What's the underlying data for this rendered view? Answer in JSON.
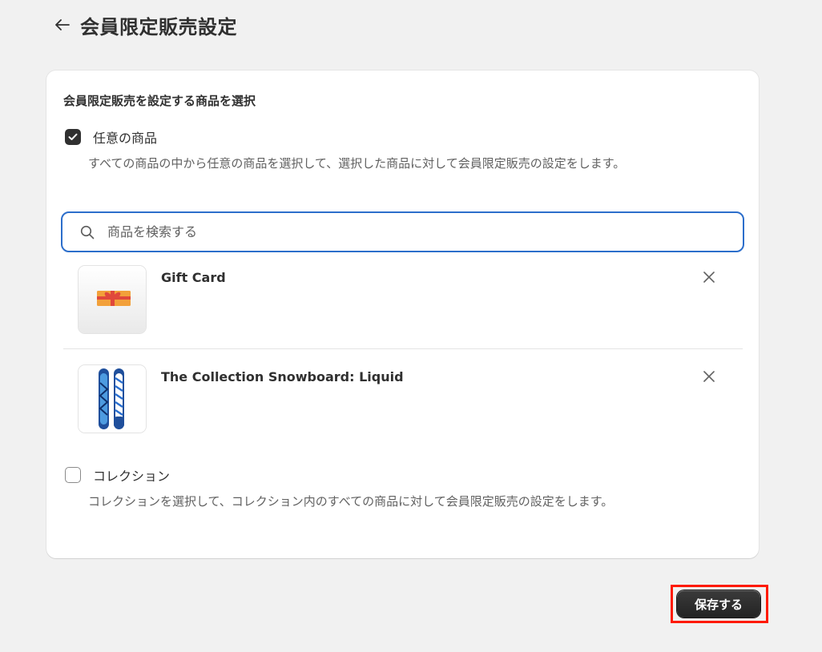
{
  "header": {
    "title": "会員限定販売設定"
  },
  "card": {
    "section_title": "会員限定販売を設定する商品を選択",
    "options": [
      {
        "label": "任意の商品",
        "checked": true,
        "help": "すべての商品の中から任意の商品を選択して、選択した商品に対して会員限定販売の設定をします。"
      },
      {
        "label": "コレクション",
        "checked": false,
        "help": "コレクションを選択して、コレクション内のすべての商品に対して会員限定販売の設定をします。"
      }
    ],
    "search": {
      "placeholder": "商品を検索する",
      "value": ""
    },
    "products": [
      {
        "name": "Gift Card"
      },
      {
        "name": "The Collection Snowboard: Liquid"
      }
    ]
  },
  "footer": {
    "save_label": "保存する"
  },
  "colors": {
    "background": "#f1f1f1",
    "card": "#ffffff",
    "focus": "#2c6ecb",
    "primary_button": "#303030",
    "highlight": "#ff1a00"
  }
}
